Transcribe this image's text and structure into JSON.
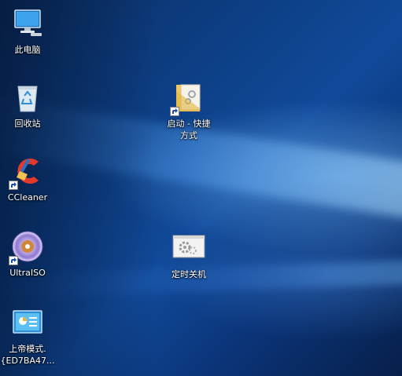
{
  "desktop": {
    "icons": [
      {
        "id": "this-pc",
        "label": "此电脑"
      },
      {
        "id": "recycle-bin",
        "label": "回收站"
      },
      {
        "id": "ccleaner",
        "label": "CCleaner"
      },
      {
        "id": "ultraiso",
        "label": "UltraISO"
      },
      {
        "id": "god-mode",
        "label": "上帝模式.\n{ED7BA47..."
      },
      {
        "id": "startup-shortcut",
        "label": "启动 - 快捷\n方式"
      },
      {
        "id": "timed-shutdown",
        "label": "定时关机"
      }
    ]
  },
  "colors": {
    "wallpaper_dark": "#0a2a55",
    "wallpaper_light": "#7fc2ff",
    "label_text": "#ffffff"
  },
  "icon_names": [
    "monitor-icon",
    "recycle-bin-icon",
    "ccleaner-icon",
    "ultraiso-disc-icon",
    "control-panel-icon",
    "folder-icon",
    "settings-gear-icon",
    "shortcut-arrow-icon"
  ]
}
